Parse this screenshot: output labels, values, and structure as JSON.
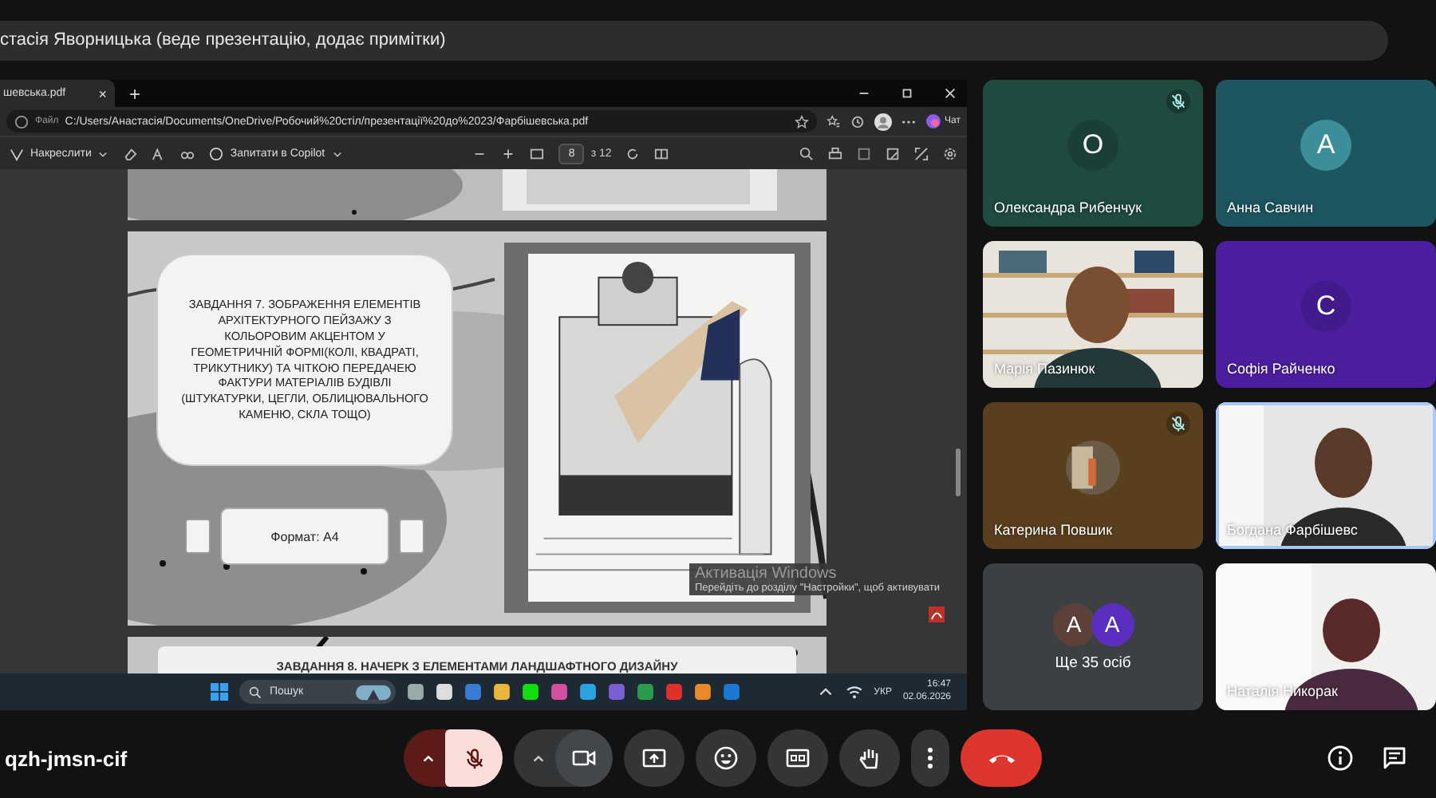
{
  "presenter_banner": "стасія Яворницька (веде презентацію, додає примітки)",
  "browser": {
    "tab": {
      "title": "шевська.pdf",
      "close": "×"
    },
    "new_tab": "+",
    "address": {
      "scheme": "Файл",
      "url": "C:/Users/Анастасія/Documents/OneDrive/Робочий%20стіл/презентації%20до%2023/Фарбішевська.pdf"
    },
    "chat_button": "Чат",
    "pdf_toolbar": {
      "draw": "Накреслити",
      "copilot": "Запитати в Copilot",
      "page": "8",
      "page_total": "з 12"
    },
    "slides": [
      {
        "kind": "tail"
      },
      {
        "kind": "task",
        "task_text": "ЗАВДАННЯ 7. ЗОБРАЖЕННЯ ЕЛЕМЕНТІВ АРХІТЕКТУРНОГО ПЕЙЗАЖУ З КОЛЬОРОВИМ АКЦЕНТОМ У ГЕОМЕТРИЧНІЙ ФОРМІ(КОЛІ, КВАДРАТІ, ТРИКУТНИКУ) ТА ЧІТКОЮ ПЕРЕДАЧЕЮ ФАКТУРИ МАТЕРІАЛІВ БУДІВЛІ (ШТУКАТУРКИ, ЦЕГЛИ, ОБЛИЦЮВАЛЬНОГО КАМЕНЮ, СКЛА ТОЩО)",
        "format_label": "Формат: А4"
      },
      {
        "kind": "head",
        "heading": "ЗАВДАННЯ 8. НАЧЕРК З ЕЛЕМЕНТАМИ ЛАНДШАФТНОГО ДИЗАЙНУ"
      }
    ]
  },
  "activation_notice": {
    "title": "Активація Windows",
    "text": "Перейдіть до розділу \"Настройки\", щоб активувати"
  },
  "taskbar": {
    "search_placeholder": "Пошук",
    "language": "УКР",
    "time": "16:47",
    "date": "02.06.2026"
  },
  "participants": [
    {
      "kind": "avatar",
      "name": "Олександра Рибенчук",
      "initial": "О",
      "muted": true,
      "speaking": false,
      "color": "#1f4a40"
    },
    {
      "kind": "avatar",
      "name": "Анна Савчин",
      "initial": "А",
      "muted": false,
      "speaking": false,
      "color": "#1d5660"
    },
    {
      "kind": "video",
      "name": "Марія Пазинюк",
      "muted": false,
      "speaking": false
    },
    {
      "kind": "avatar",
      "name": "Софія Райченко",
      "initial": "С",
      "muted": false,
      "speaking": false,
      "color": "#4b1fa0"
    },
    {
      "name": "Катерина Повшик",
      "muted": true,
      "speaking": false,
      "color": "#5a3f1e"
    },
    {
      "kind": "video",
      "name": "Богдана Фарбішевс",
      "muted": false,
      "speaking": true
    },
    {
      "kind": "overflow",
      "initials": [
        "А",
        "А"
      ],
      "label": "Ще 35 осіб"
    },
    {
      "kind": "video",
      "name": "Наталія Никорак",
      "muted": false,
      "speaking": false
    }
  ],
  "meeting_code": "qzh-jmsn-cif",
  "controls": [
    {
      "kind": "mic",
      "on": false
    },
    {
      "kind": "camera",
      "on": true
    },
    {
      "kind": "present"
    },
    {
      "kind": "emoji"
    },
    {
      "kind": "captions"
    },
    {
      "kind": "hand",
      "selected": false
    },
    {
      "kind": "more"
    },
    {
      "kind": "leave"
    }
  ]
}
